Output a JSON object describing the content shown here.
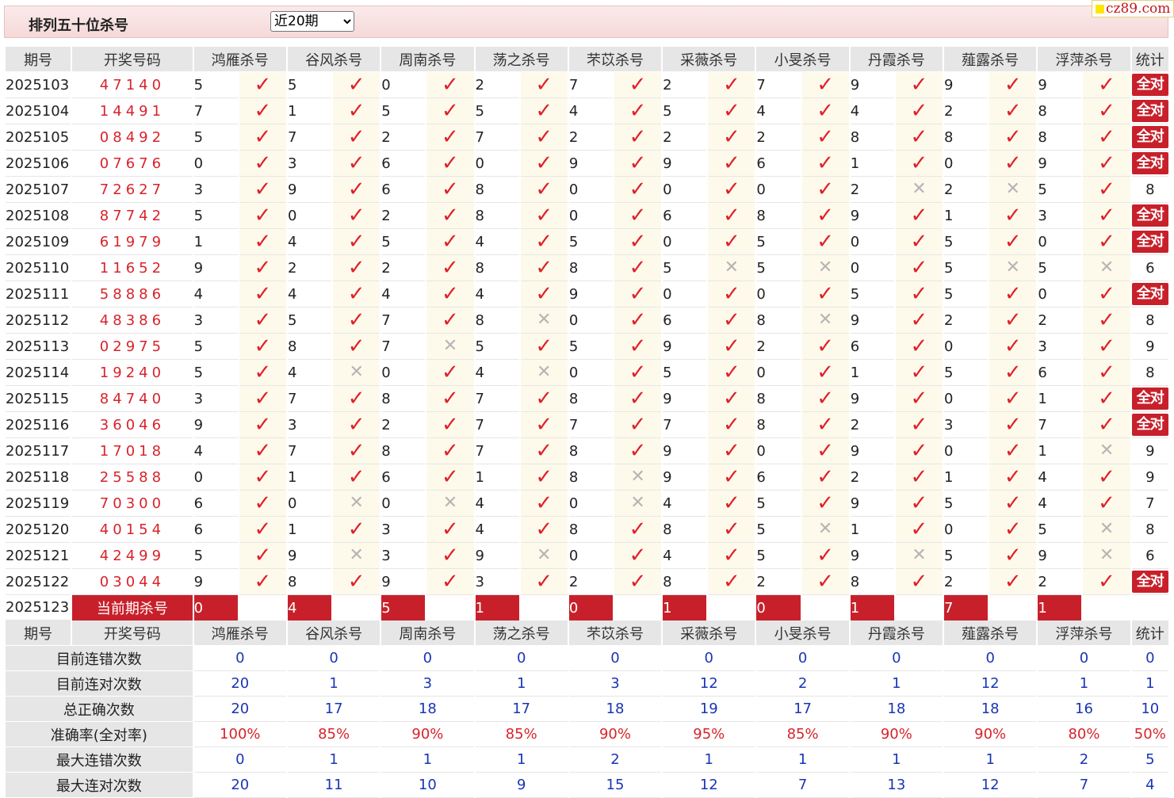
{
  "header": {
    "title": "排列五十位杀号",
    "period_select": {
      "selected": "近20期"
    }
  },
  "logo": {
    "text": "cz89.com"
  },
  "columns": {
    "issue": "期号",
    "draw": "开奖号码",
    "experts": [
      "鸿雁杀号",
      "谷风杀号",
      "周南杀号",
      "荡之杀号",
      "芣苡杀号",
      "采薇杀号",
      "小旻杀号",
      "丹霞杀号",
      "薤露杀号",
      "浮萍杀号"
    ],
    "stat": "统计"
  },
  "rows": [
    {
      "issue": "2025103",
      "draw": "47140",
      "kills": [
        5,
        5,
        0,
        2,
        7,
        2,
        7,
        9,
        9,
        9
      ],
      "hits": [
        1,
        1,
        1,
        1,
        1,
        1,
        1,
        1,
        1,
        1
      ],
      "stat": "全对"
    },
    {
      "issue": "2025104",
      "draw": "14491",
      "kills": [
        7,
        1,
        5,
        5,
        4,
        5,
        4,
        4,
        2,
        8
      ],
      "hits": [
        1,
        1,
        1,
        1,
        1,
        1,
        1,
        1,
        1,
        1
      ],
      "stat": "全对"
    },
    {
      "issue": "2025105",
      "draw": "08492",
      "kills": [
        5,
        7,
        2,
        7,
        2,
        2,
        2,
        8,
        8,
        8
      ],
      "hits": [
        1,
        1,
        1,
        1,
        1,
        1,
        1,
        1,
        1,
        1
      ],
      "stat": "全对"
    },
    {
      "issue": "2025106",
      "draw": "07676",
      "kills": [
        0,
        3,
        6,
        0,
        9,
        9,
        6,
        1,
        0,
        9
      ],
      "hits": [
        1,
        1,
        1,
        1,
        1,
        1,
        1,
        1,
        1,
        1
      ],
      "stat": "全对"
    },
    {
      "issue": "2025107",
      "draw": "72627",
      "kills": [
        3,
        9,
        6,
        8,
        0,
        0,
        0,
        2,
        2,
        5
      ],
      "hits": [
        1,
        1,
        1,
        1,
        1,
        1,
        1,
        0,
        0,
        1
      ],
      "stat": "8"
    },
    {
      "issue": "2025108",
      "draw": "87742",
      "kills": [
        5,
        0,
        2,
        8,
        0,
        6,
        8,
        9,
        1,
        3
      ],
      "hits": [
        1,
        1,
        1,
        1,
        1,
        1,
        1,
        1,
        1,
        1
      ],
      "stat": "全对"
    },
    {
      "issue": "2025109",
      "draw": "61979",
      "kills": [
        1,
        4,
        5,
        4,
        5,
        0,
        5,
        0,
        5,
        0
      ],
      "hits": [
        1,
        1,
        1,
        1,
        1,
        1,
        1,
        1,
        1,
        1
      ],
      "stat": "全对"
    },
    {
      "issue": "2025110",
      "draw": "11652",
      "kills": [
        9,
        2,
        2,
        8,
        8,
        5,
        5,
        0,
        5,
        5
      ],
      "hits": [
        1,
        1,
        1,
        1,
        1,
        0,
        0,
        1,
        0,
        0
      ],
      "stat": "6"
    },
    {
      "issue": "2025111",
      "draw": "58886",
      "kills": [
        4,
        4,
        4,
        4,
        9,
        0,
        0,
        5,
        5,
        0
      ],
      "hits": [
        1,
        1,
        1,
        1,
        1,
        1,
        1,
        1,
        1,
        1
      ],
      "stat": "全对"
    },
    {
      "issue": "2025112",
      "draw": "48386",
      "kills": [
        3,
        5,
        7,
        8,
        0,
        6,
        8,
        9,
        2,
        2
      ],
      "hits": [
        1,
        1,
        1,
        0,
        1,
        1,
        0,
        1,
        1,
        1
      ],
      "stat": "8"
    },
    {
      "issue": "2025113",
      "draw": "02975",
      "kills": [
        5,
        8,
        7,
        5,
        5,
        9,
        2,
        6,
        0,
        3
      ],
      "hits": [
        1,
        1,
        0,
        1,
        1,
        1,
        1,
        1,
        1,
        1
      ],
      "stat": "9"
    },
    {
      "issue": "2025114",
      "draw": "19240",
      "kills": [
        5,
        4,
        0,
        4,
        0,
        5,
        0,
        1,
        5,
        6
      ],
      "hits": [
        1,
        0,
        1,
        0,
        1,
        1,
        1,
        1,
        1,
        1
      ],
      "stat": "8"
    },
    {
      "issue": "2025115",
      "draw": "84740",
      "kills": [
        3,
        7,
        8,
        7,
        8,
        9,
        8,
        9,
        0,
        1
      ],
      "hits": [
        1,
        1,
        1,
        1,
        1,
        1,
        1,
        1,
        1,
        1
      ],
      "stat": "全对"
    },
    {
      "issue": "2025116",
      "draw": "36046",
      "kills": [
        9,
        3,
        2,
        7,
        7,
        7,
        8,
        2,
        3,
        7
      ],
      "hits": [
        1,
        1,
        1,
        1,
        1,
        1,
        1,
        1,
        1,
        1
      ],
      "stat": "全对"
    },
    {
      "issue": "2025117",
      "draw": "17018",
      "kills": [
        4,
        7,
        8,
        7,
        8,
        9,
        0,
        9,
        0,
        1
      ],
      "hits": [
        1,
        1,
        1,
        1,
        1,
        1,
        1,
        1,
        1,
        0
      ],
      "stat": "9"
    },
    {
      "issue": "2025118",
      "draw": "25588",
      "kills": [
        0,
        1,
        6,
        1,
        8,
        9,
        6,
        2,
        1,
        4
      ],
      "hits": [
        1,
        1,
        1,
        1,
        0,
        1,
        1,
        1,
        1,
        1
      ],
      "stat": "9"
    },
    {
      "issue": "2025119",
      "draw": "70300",
      "kills": [
        6,
        0,
        0,
        4,
        0,
        4,
        5,
        9,
        5,
        4
      ],
      "hits": [
        1,
        0,
        0,
        1,
        0,
        1,
        1,
        1,
        1,
        1
      ],
      "stat": "7"
    },
    {
      "issue": "2025120",
      "draw": "40154",
      "kills": [
        6,
        1,
        3,
        4,
        8,
        8,
        5,
        1,
        0,
        5
      ],
      "hits": [
        1,
        1,
        1,
        1,
        1,
        1,
        0,
        1,
        1,
        0
      ],
      "stat": "8"
    },
    {
      "issue": "2025121",
      "draw": "42499",
      "kills": [
        5,
        9,
        3,
        9,
        0,
        4,
        5,
        9,
        5,
        9
      ],
      "hits": [
        1,
        0,
        1,
        0,
        1,
        1,
        1,
        0,
        1,
        0
      ],
      "stat": "6"
    },
    {
      "issue": "2025122",
      "draw": "03044",
      "kills": [
        9,
        8,
        9,
        3,
        2,
        8,
        2,
        8,
        2,
        2
      ],
      "hits": [
        1,
        1,
        1,
        1,
        1,
        1,
        1,
        1,
        1,
        1
      ],
      "stat": "全对"
    }
  ],
  "current": {
    "issue": "2025123",
    "label": "当前期杀号",
    "kills": [
      "0",
      "4",
      "5",
      "1",
      "0",
      "1",
      "0",
      "1",
      "7",
      "1"
    ]
  },
  "summary": [
    {
      "label": "目前连错次数",
      "values": [
        "0",
        "0",
        "0",
        "0",
        "0",
        "0",
        "0",
        "0",
        "0",
        "0"
      ],
      "stat": "0",
      "red": false
    },
    {
      "label": "目前连对次数",
      "values": [
        "20",
        "1",
        "3",
        "1",
        "3",
        "12",
        "2",
        "1",
        "12",
        "1"
      ],
      "stat": "1",
      "red": false
    },
    {
      "label": "总正确次数",
      "values": [
        "20",
        "17",
        "18",
        "17",
        "18",
        "19",
        "17",
        "18",
        "18",
        "16"
      ],
      "stat": "10",
      "red": false
    },
    {
      "label": "准确率(全对率)",
      "values": [
        "100%",
        "85%",
        "90%",
        "85%",
        "90%",
        "95%",
        "85%",
        "90%",
        "90%",
        "80%"
      ],
      "stat": "50%",
      "red": true
    },
    {
      "label": "最大连错次数",
      "values": [
        "0",
        "1",
        "1",
        "1",
        "2",
        "1",
        "1",
        "1",
        "1",
        "2"
      ],
      "stat": "5",
      "red": false
    },
    {
      "label": "最大连对次数",
      "values": [
        "20",
        "11",
        "10",
        "9",
        "15",
        "12",
        "7",
        "13",
        "12",
        "7"
      ],
      "stat": "4",
      "red": false
    }
  ],
  "marks": {
    "hit": "✓",
    "miss": "✕"
  },
  "colors": {
    "accent_red": "#c8202b",
    "draw_red": "#d8232a",
    "stat_blue": "#1a35b5",
    "hit_bg": "#fdfaeb",
    "header_bg": "#e6e6e6"
  }
}
